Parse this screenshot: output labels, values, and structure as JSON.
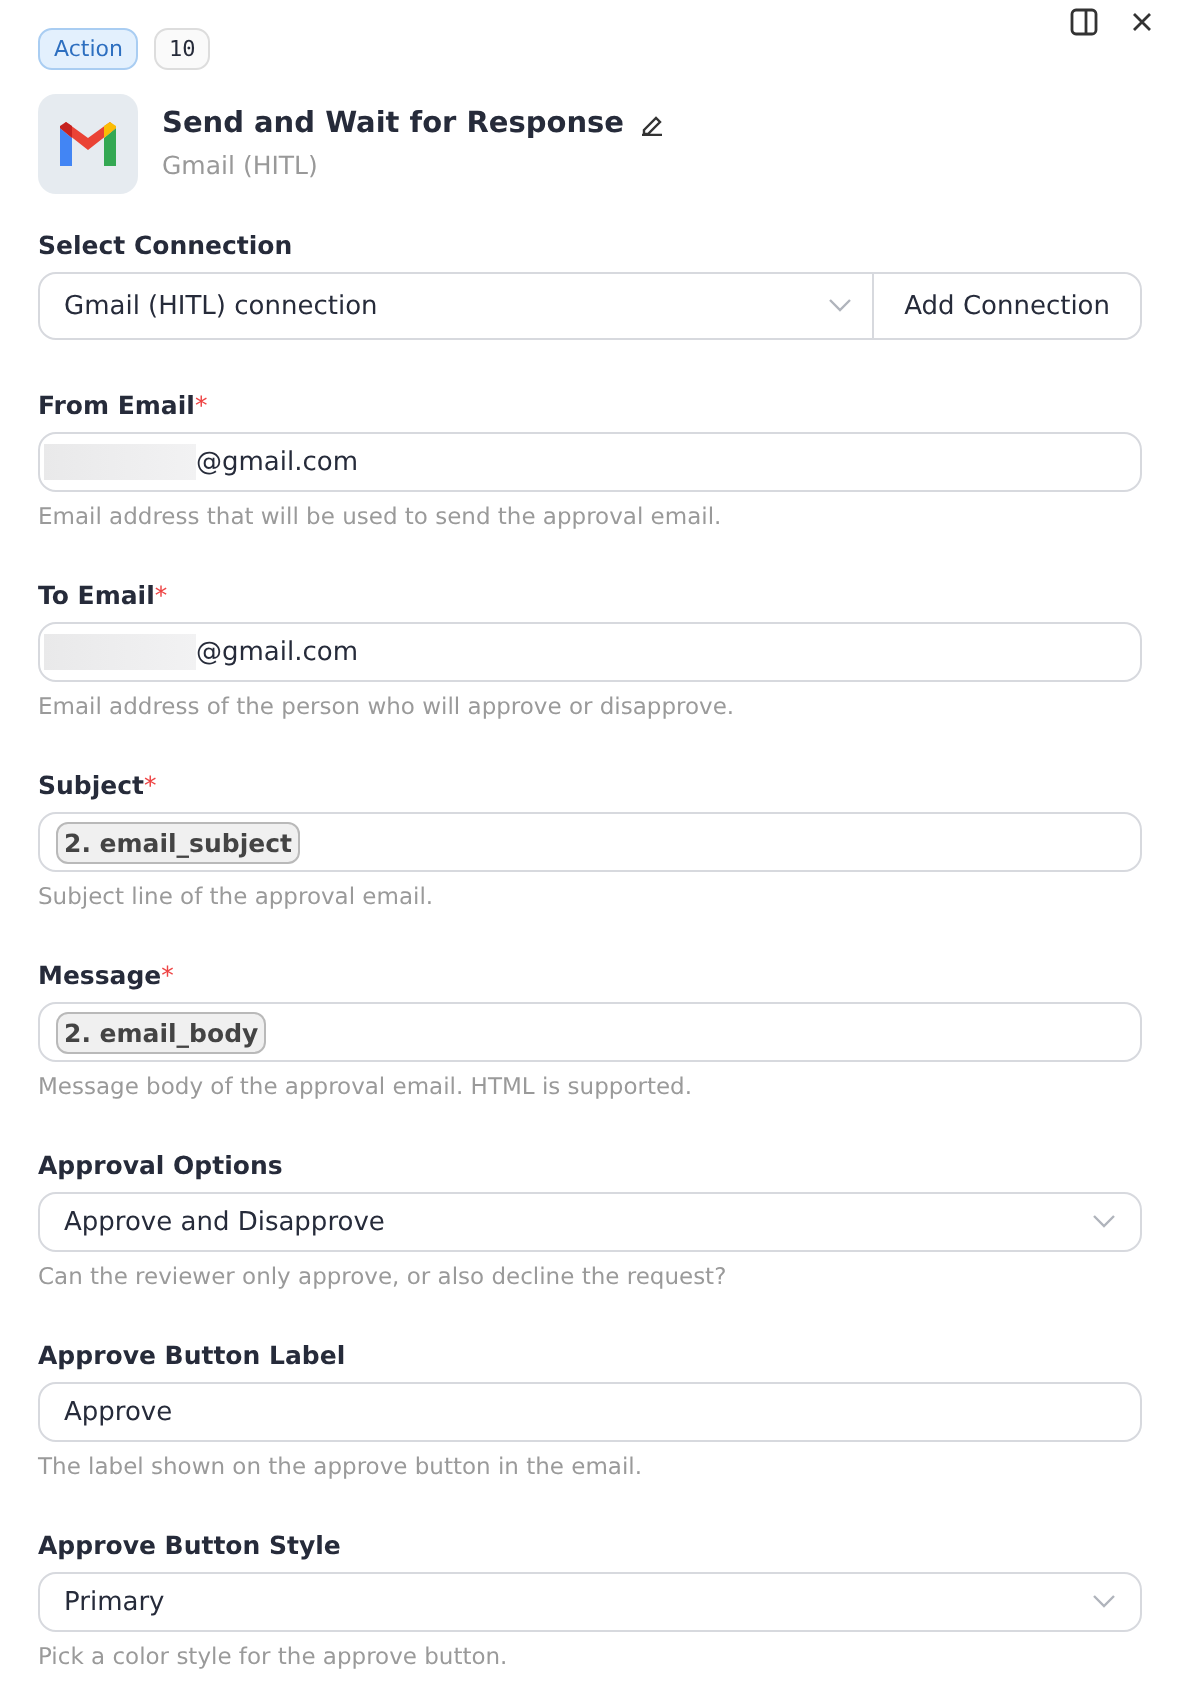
{
  "header": {
    "badge": "Action",
    "step": "10",
    "title": "Send and Wait for Response",
    "subtitle": "Gmail (HITL)"
  },
  "fields": [
    {
      "kind": "connection",
      "label": "Select Connection",
      "value": "Gmail (HITL) connection",
      "button": "Add Connection"
    },
    {
      "kind": "text",
      "label": "From Email",
      "required_mark": "*",
      "redacted": true,
      "value": "@gmail.com",
      "hint": "Email address that will be used to send the approval email."
    },
    {
      "kind": "text",
      "label": "To Email",
      "required_mark": "*",
      "redacted": true,
      "value": "@gmail.com",
      "hint": "Email address of the person who will approve or disapprove."
    },
    {
      "kind": "chip",
      "label": "Subject",
      "required_mark": "*",
      "value": "2. email_subject",
      "hint": "Subject line of the approval email."
    },
    {
      "kind": "chip",
      "label": "Message",
      "required_mark": "*",
      "value": "2. email_body",
      "hint": "Message body of the approval email. HTML is supported."
    },
    {
      "kind": "select",
      "label": "Approval Options",
      "value": "Approve and Disapprove",
      "hint": "Can the reviewer only approve, or also decline the request?"
    },
    {
      "kind": "text",
      "label": "Approve Button Label",
      "redacted": false,
      "value": "Approve",
      "hint": "The label shown on the approve button in the email."
    },
    {
      "kind": "select",
      "label": "Approve Button Style",
      "value": "Primary",
      "hint": "Pick a color style for the approve button."
    }
  ]
}
